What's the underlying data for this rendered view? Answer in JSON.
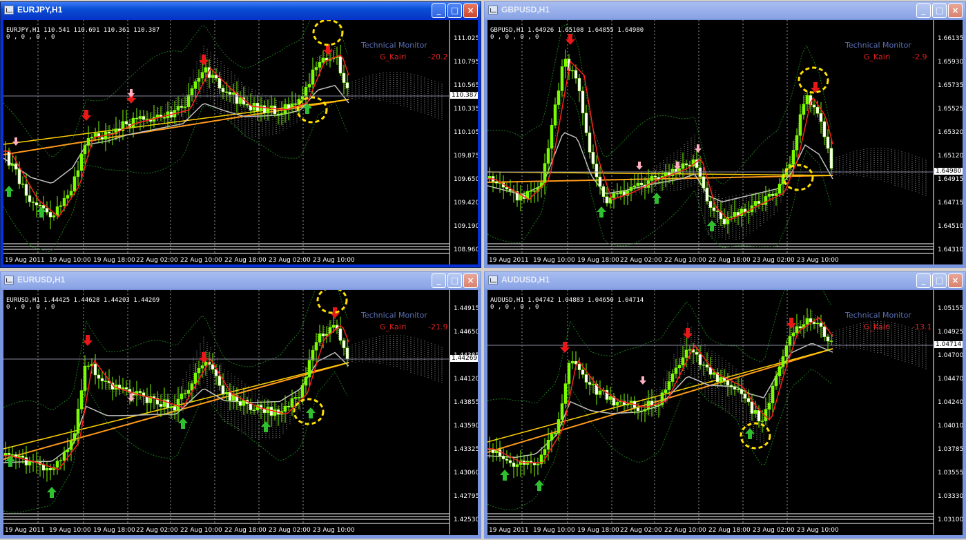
{
  "colors": {
    "bull": "#7cfc00",
    "bear": "#ffffff",
    "ma_red": "#ff2020",
    "ma_orange": "#ff9a1a",
    "ma_yellow": "#ffd000",
    "ma_gray": "#c0c0c0",
    "band": "#1a7a1a",
    "cloud": "#d0d0d0",
    "highlight": "#ffe000"
  },
  "indicator": {
    "tm_label": "Technical  Monitor",
    "gk_label": "G_Kairi"
  },
  "window_buttons": {
    "minimize": "_",
    "maximize": "□",
    "close": "×"
  },
  "windows": [
    {
      "title": "EURJPY,H1",
      "active": true,
      "info": "EURJPY,H1  110.541 110.691 110.361 110.387",
      "info2": "0 , 0 , 0 , 0",
      "kairi": "-20.2",
      "current": "110.387",
      "yticks": [
        "111.025",
        "110.795",
        "110.565",
        "110.335",
        "110.105",
        "109.875",
        "109.650",
        "109.420",
        "109.190",
        "108.960"
      ]
    },
    {
      "title": "GBPUSD,H1",
      "active": false,
      "info": "GBPUSD,H1  1.64926 1.65108 1.64855 1.64980",
      "info2": "0 , 0 , 0 , 0",
      "kairi": "-2.9",
      "current": "1.64980",
      "yticks": [
        "1.66135",
        "1.65930",
        "1.65735",
        "1.65525",
        "1.65320",
        "1.65120",
        "1.64915",
        "1.64715",
        "1.64510",
        "1.64310"
      ]
    },
    {
      "title": "EURUSD,H1",
      "active": false,
      "info": "EURUSD,H1  1.44425 1.44628 1.44203 1.44269",
      "info2": "0 , 0 , 0 , 0",
      "kairi": "-21.9",
      "current": "1.44269",
      "yticks": [
        "1.44915",
        "1.44650",
        "1.44385",
        "1.44120",
        "1.43855",
        "1.43590",
        "1.43325",
        "1.43060",
        "1.42795",
        "1.42530"
      ]
    },
    {
      "title": "AUDUSD,H1",
      "active": false,
      "info": "AUDUSD,H1  1.04742 1.04883 1.04650 1.04714",
      "info2": "0 , 0 , 0 , 0",
      "kairi": "-13.1",
      "current": "1.04714",
      "yticks": [
        "1.05155",
        "1.04925",
        "1.04700",
        "1.04470",
        "1.04240",
        "1.04010",
        "1.03785",
        "1.03555",
        "1.03330",
        "1.03100"
      ]
    }
  ],
  "xticks": [
    "19 Aug 2011",
    "19 Aug 10:00",
    "19 Aug 18:00",
    "22 Aug 02:00",
    "22 Aug 10:00",
    "22 Aug 18:00",
    "23 Aug 02:00",
    "23 Aug 10:00"
  ]
}
